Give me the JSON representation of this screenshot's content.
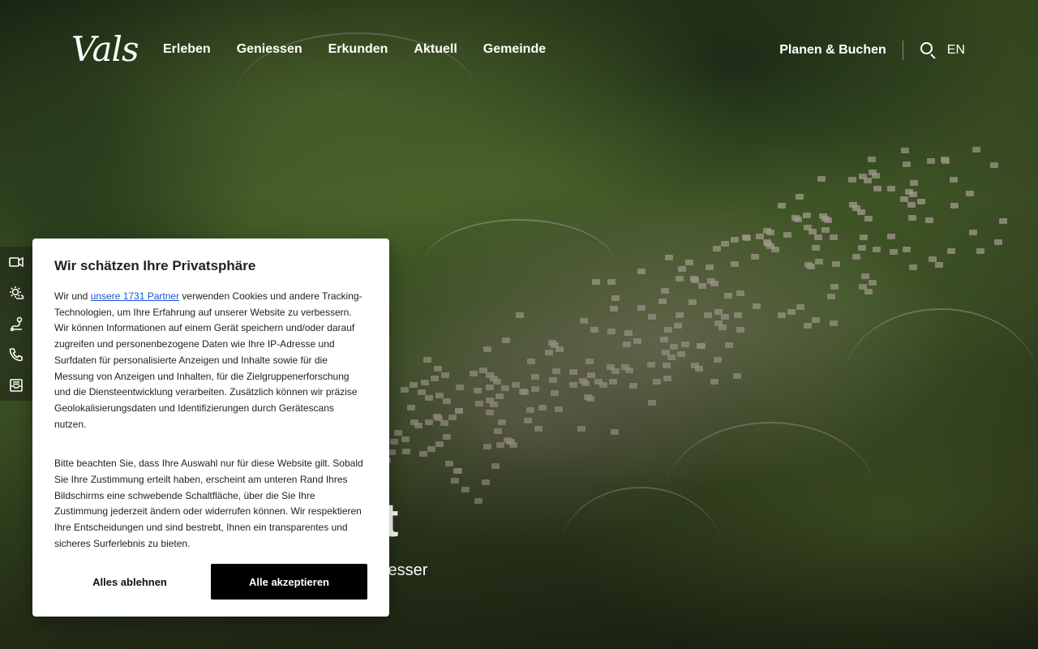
{
  "header": {
    "logo_text": "Vals",
    "nav": [
      "Erleben",
      "Geniessen",
      "Erkunden",
      "Aktuell",
      "Gemeinde"
    ],
    "plan_label": "Planen & Buchen",
    "search_icon": "search-icon",
    "language": "EN"
  },
  "side_toolbar": {
    "icons": [
      "webcam-icon",
      "weather-icon",
      "route-icon",
      "phone-icon",
      "inbox-icon"
    ]
  },
  "hero": {
    "title_fragment": "t",
    "subtitle_fragment": "iesser"
  },
  "consent": {
    "title": "Wir schätzen Ihre Privatsphäre",
    "p1_before": "Wir und ",
    "p1_link": "unsere 1731 Partner",
    "p1_after": " verwenden Cookies und andere Tracking-Technologien, um Ihre Erfahrung auf unserer Website zu verbessern. Wir können Informationen auf einem Gerät speichern und/oder darauf zugreifen und personenbezogene Daten wie Ihre IP-Adresse und Surfdaten für personalisierte Anzeigen und Inhalte sowie für die Messung von Anzeigen und Inhalten, für die Zielgruppenerforschung und die Diensteentwicklung verarbeiten. Zusätzlich können wir präzise Geolokalisierungsdaten und Identifizierungen durch Gerätescans nutzen.",
    "p2": "Bitte beachten Sie, dass Ihre Auswahl nur für diese Website gilt. Sobald Sie Ihre Zustimmung erteilt haben, erscheint am unteren Rand Ihres Bildschirms eine schwebende Schaltfläche, über die Sie Ihre Zustimmung jederzeit ändern oder widerrufen können. Wir respektieren Ihre Entscheidungen und sind bestrebt, Ihnen ein transparentes und sicheres Surferlebnis zu bieten.",
    "reject_label": "Alles ablehnen",
    "accept_label": "Alle akzeptieren",
    "link_color": "#1a56d6"
  }
}
